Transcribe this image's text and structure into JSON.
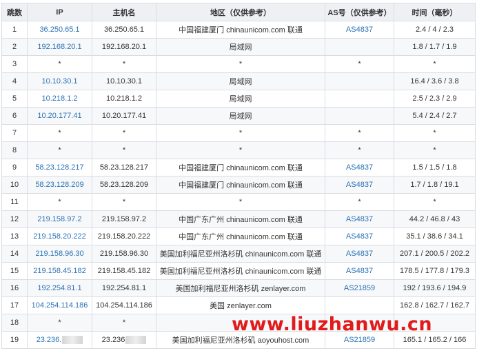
{
  "columns": [
    "跳数",
    "IP",
    "主机名",
    "地区（仅供参考）",
    "AS号（仅供参考）",
    "时间（毫秒）"
  ],
  "rows": [
    {
      "hop": "1",
      "ip": "36.250.65.1",
      "host": "36.250.65.1",
      "region": "中国福建厦门 chinaunicom.com 联通",
      "as": "AS4837",
      "time": "2.4 / 4 / 2.3"
    },
    {
      "hop": "2",
      "ip": "192.168.20.1",
      "host": "192.168.20.1",
      "region": "局域网",
      "as": "",
      "time": "1.8 / 1.7 / 1.9"
    },
    {
      "hop": "3",
      "ip": "*",
      "host": "*",
      "region": "*",
      "as": "*",
      "time": "*"
    },
    {
      "hop": "4",
      "ip": "10.10.30.1",
      "host": "10.10.30.1",
      "region": "局域网",
      "as": "",
      "time": "16.4 / 3.6 / 3.8"
    },
    {
      "hop": "5",
      "ip": "10.218.1.2",
      "host": "10.218.1.2",
      "region": "局域网",
      "as": "",
      "time": "2.5 / 2.3 / 2.9"
    },
    {
      "hop": "6",
      "ip": "10.20.177.41",
      "host": "10.20.177.41",
      "region": "局域网",
      "as": "",
      "time": "5.4 / 2.4 / 2.7"
    },
    {
      "hop": "7",
      "ip": "*",
      "host": "*",
      "region": "*",
      "as": "*",
      "time": "*"
    },
    {
      "hop": "8",
      "ip": "*",
      "host": "*",
      "region": "*",
      "as": "*",
      "time": "*"
    },
    {
      "hop": "9",
      "ip": "58.23.128.217",
      "host": "58.23.128.217",
      "region": "中国福建厦门 chinaunicom.com 联通",
      "as": "AS4837",
      "time": "1.5 / 1.5 / 1.8"
    },
    {
      "hop": "10",
      "ip": "58.23.128.209",
      "host": "58.23.128.209",
      "region": "中国福建厦门 chinaunicom.com 联通",
      "as": "AS4837",
      "time": "1.7 / 1.8 / 19.1"
    },
    {
      "hop": "11",
      "ip": "*",
      "host": "*",
      "region": "*",
      "as": "*",
      "time": "*"
    },
    {
      "hop": "12",
      "ip": "219.158.97.2",
      "host": "219.158.97.2",
      "region": "中国广东广州 chinaunicom.com 联通",
      "as": "AS4837",
      "time": "44.2 / 46.8 / 43"
    },
    {
      "hop": "13",
      "ip": "219.158.20.222",
      "host": "219.158.20.222",
      "region": "中国广东广州 chinaunicom.com 联通",
      "as": "AS4837",
      "time": "35.1 / 38.6 / 34.1"
    },
    {
      "hop": "14",
      "ip": "219.158.96.30",
      "host": "219.158.96.30",
      "region": "美国加利福尼亚州洛杉矶 chinaunicom.com 联通",
      "as": "AS4837",
      "time": "207.1 / 200.5 / 202.2"
    },
    {
      "hop": "15",
      "ip": "219.158.45.182",
      "host": "219.158.45.182",
      "region": "美国加利福尼亚州洛杉矶 chinaunicom.com 联通",
      "as": "AS4837",
      "time": "178.5 / 177.8 / 179.3"
    },
    {
      "hop": "16",
      "ip": "192.254.81.1",
      "host": "192.254.81.1",
      "region": "美国加利福尼亚州洛杉矶 zenlayer.com",
      "as": "AS21859",
      "time": "192 / 193.6 / 194.9"
    },
    {
      "hop": "17",
      "ip": "104.254.114.186",
      "host": "104.254.114.186",
      "region": "美国 zenlayer.com",
      "as": "",
      "time": "162.8 / 162.7 / 162.7"
    },
    {
      "hop": "18",
      "ip": "*",
      "host": "*",
      "region": "*",
      "as": "",
      "time": ""
    },
    {
      "hop": "19",
      "ip": "23.236.",
      "host": "23.236",
      "region": "美国加利福尼亚州洛杉矶 aoyouhost.com",
      "as": "AS21859",
      "time": "165.1 / 165.2 / 166",
      "masked": true
    }
  ],
  "watermark": "www.liuzhanwu.cn",
  "colors": {
    "link": "#2a72b5",
    "header_bg": "#eef0f4",
    "stripe_bg": "#f7f8fa",
    "border": "#d9dde2",
    "watermark": "#e21a1a"
  }
}
